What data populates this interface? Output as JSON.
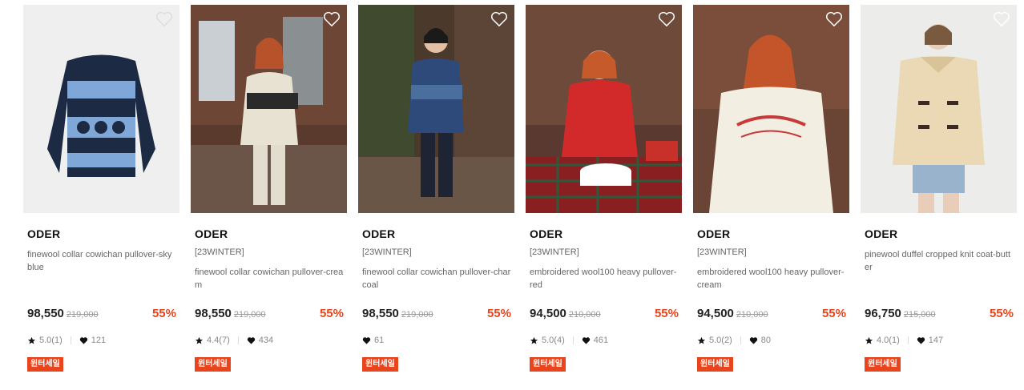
{
  "products": [
    {
      "brand": "ODER",
      "season": "",
      "name": "finewool collar cowichan pullover-sky blue",
      "price": "98,550",
      "original_price": "219,000",
      "discount": "55%",
      "rating": "5.0(1)",
      "likes": "121",
      "badge": "윈터세일"
    },
    {
      "brand": "ODER",
      "season": "[23WINTER]",
      "name": "finewool collar cowichan pullover-cream",
      "price": "98,550",
      "original_price": "219,000",
      "discount": "55%",
      "rating": "4.4(7)",
      "likes": "434",
      "badge": "윈터세일"
    },
    {
      "brand": "ODER",
      "season": "[23WINTER]",
      "name": "finewool collar cowichan pullover-charcoal",
      "price": "98,550",
      "original_price": "219,000",
      "discount": "55%",
      "rating": "",
      "likes": "61",
      "badge": "윈터세일"
    },
    {
      "brand": "ODER",
      "season": "[23WINTER]",
      "name": "embroidered wool100 heavy pullover-red",
      "price": "94,500",
      "original_price": "210,000",
      "discount": "55%",
      "rating": "5.0(4)",
      "likes": "461",
      "badge": "윈터세일"
    },
    {
      "brand": "ODER",
      "season": "[23WINTER]",
      "name": "embroidered wool100 heavy pullover-cream",
      "price": "94,500",
      "original_price": "210,000",
      "discount": "55%",
      "rating": "5.0(2)",
      "likes": "80",
      "badge": "윈터세일"
    },
    {
      "brand": "ODER",
      "season": "",
      "name": "pinewool duffel cropped knit coat-butter",
      "price": "96,750",
      "original_price": "215,000",
      "discount": "55%",
      "rating": "4.0(1)",
      "likes": "147",
      "badge": "윈터세일"
    }
  ],
  "icons": {
    "wishlist": "heart-outline-icon",
    "rating": "star-icon",
    "likes": "heart-filled-icon"
  },
  "colors": {
    "discount": "#e8451e",
    "badge_bg": "#e8451e",
    "price": "#222222",
    "muted": "#888888"
  }
}
